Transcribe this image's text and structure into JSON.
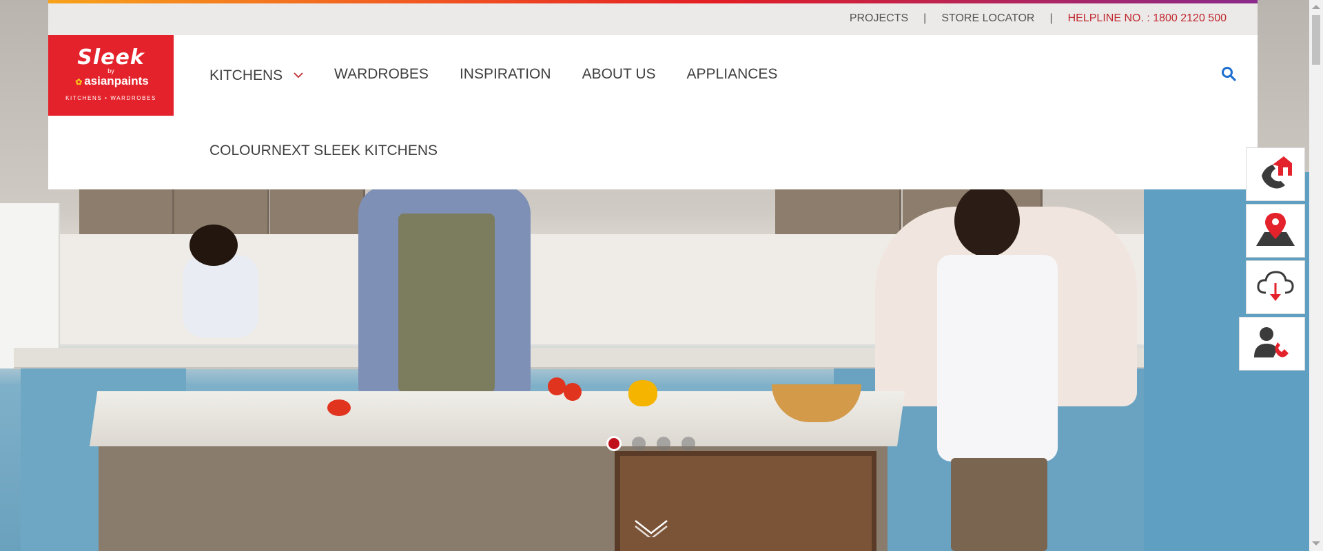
{
  "topbar": {
    "projects": "PROJECTS",
    "store_locator": "STORE LOCATOR",
    "helpline": "HELPLINE NO. : 1800 2120 500"
  },
  "logo": {
    "brand": "Sleek",
    "by": "by",
    "partner": "asianpaints",
    "tagline": "KITCHENS • WARDROBES"
  },
  "nav": {
    "items": [
      {
        "label": "KITCHENS",
        "icon": "chevron-down-icon"
      },
      {
        "label": "WARDROBES"
      },
      {
        "label": "INSPIRATION"
      },
      {
        "label": "ABOUT US"
      },
      {
        "label": "APPLIANCES"
      }
    ],
    "second_row": "COLOURNEXT SLEEK KITCHENS",
    "search_icon": "search-icon"
  },
  "floating_actions": [
    {
      "icon": "home-call-icon"
    },
    {
      "icon": "location-pin-icon"
    },
    {
      "icon": "cloud-download-icon"
    },
    {
      "icon": "contact-person-icon"
    }
  ],
  "carousel": {
    "slide_count": 4,
    "active_index": 0
  },
  "colors": {
    "brand_red": "#e4222b",
    "helpline_red": "#c0272d",
    "accent_blue": "#1d6fd1",
    "active_dot": "#c0101c"
  }
}
